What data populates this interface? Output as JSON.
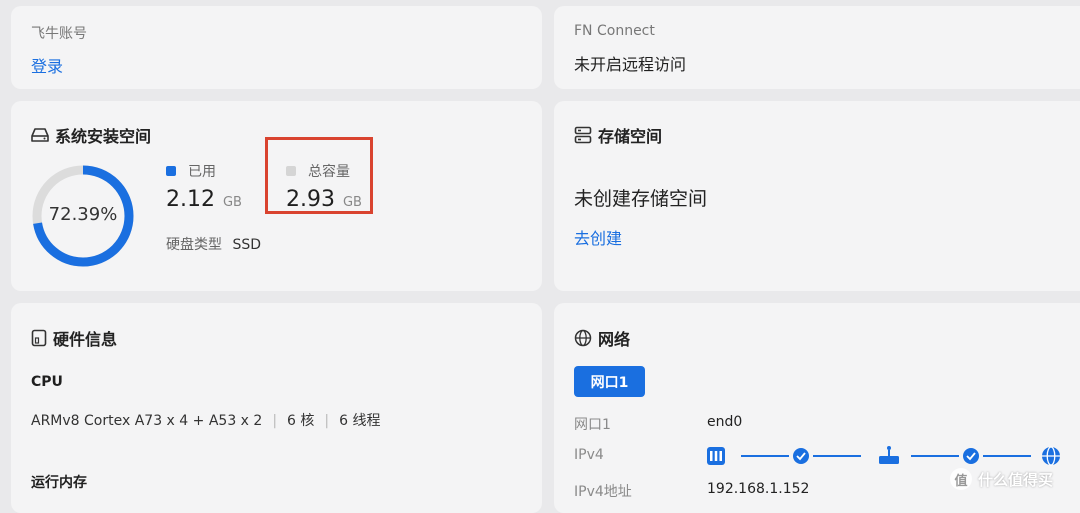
{
  "account": {
    "title": "飞牛账号",
    "login_label": "登录"
  },
  "fn_connect": {
    "title": "FN Connect",
    "status": "未开启远程访问"
  },
  "system_space": {
    "title": "系统安装空间",
    "percent": "72.39%",
    "used_ratio": 0.7239,
    "used_label": "已用",
    "used_value": "2.12",
    "used_unit": "GB",
    "total_label": "总容量",
    "total_value": "2.93",
    "total_unit": "GB",
    "disk_type_label": "硬盘类型",
    "disk_type": "SSD",
    "colors": {
      "used": "#1a6fe0",
      "remaining": "#dcdcdc",
      "highlight_box": "#d9432f"
    }
  },
  "storage": {
    "title": "存储空间",
    "empty_text": "未创建存储空间",
    "create_label": "去创建"
  },
  "hardware": {
    "title": "硬件信息",
    "cpu_label": "CPU",
    "cpu_model": "ARMv8 Cortex A73 x 4 + A53 x 2",
    "cores": "6 核",
    "threads": "6 线程",
    "memory_label": "运行内存"
  },
  "network": {
    "title": "网络",
    "tab_label": "网口1",
    "rows": {
      "port_label": "网口1",
      "port_value": "end0",
      "ipv4_label": "IPv4",
      "ipv4addr_label": "IPv4地址",
      "ipv4addr_value": "192.168.1.152"
    }
  },
  "watermark": {
    "text": "什么值得买"
  }
}
